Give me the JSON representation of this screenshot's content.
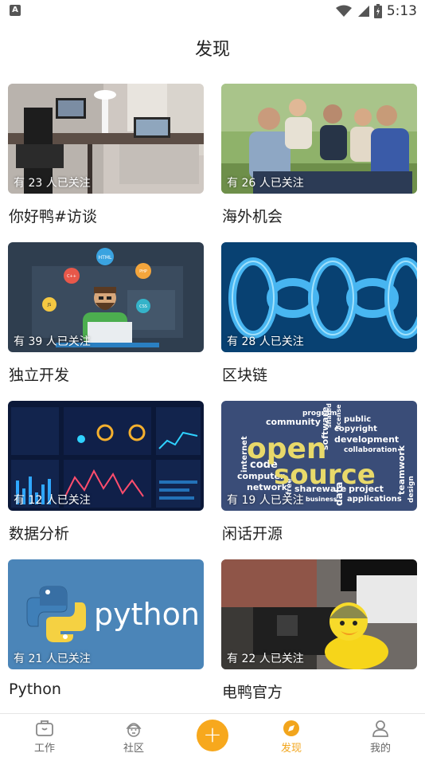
{
  "status_bar": {
    "time": "5:13",
    "notification_icon": "A"
  },
  "page_title": "发现",
  "cards": [
    {
      "title": "你好鸭#访谈",
      "followers": "有 23 人已关注",
      "image": "desk-setup-photo"
    },
    {
      "title": "海外机会",
      "followers": "有 26 人已关注",
      "image": "group-of-people-photo"
    },
    {
      "title": "独立开发",
      "followers": "有 39 人已关注",
      "image": "developer-illustration"
    },
    {
      "title": "区块链",
      "followers": "有 28 人已关注",
      "image": "blue-chain-illustration"
    },
    {
      "title": "数据分析",
      "followers": "有 12 人已关注",
      "image": "dashboard-illustration"
    },
    {
      "title": "闲话开源",
      "followers": "有 19 人已关注",
      "image": "open-source-word-cloud"
    },
    {
      "title": "Python",
      "followers": "有 21 人已关注",
      "image": "python-logo"
    },
    {
      "title": "电鸭官方",
      "followers": "有 22 人已关注",
      "image": "rubber-duck-photo"
    }
  ],
  "images": {
    "python_word": "python",
    "open_source": {
      "big1": "open",
      "big2": "source",
      "words": [
        "program",
        "community",
        "shared",
        "software",
        "license",
        "public",
        "copyright",
        "development",
        "collaboration",
        "internet",
        "code",
        "computer",
        "network",
        "free",
        "shareware",
        "project",
        "data",
        "applications",
        "business",
        "teamwork",
        "design"
      ]
    },
    "developer_bubbles": [
      "HTML",
      "CSS",
      "JS",
      "PHP",
      "C++"
    ]
  },
  "tab_bar": {
    "tabs": [
      {
        "label": "工作",
        "icon": "briefcase-icon"
      },
      {
        "label": "社区",
        "icon": "duck-community-icon"
      },
      {
        "label": "发现",
        "icon": "compass-icon",
        "active": true
      },
      {
        "label": "我的",
        "icon": "person-icon"
      }
    ],
    "add_label": "+"
  },
  "colors": {
    "accent": "#f7a81d",
    "active_tab": "#f2a51c"
  }
}
